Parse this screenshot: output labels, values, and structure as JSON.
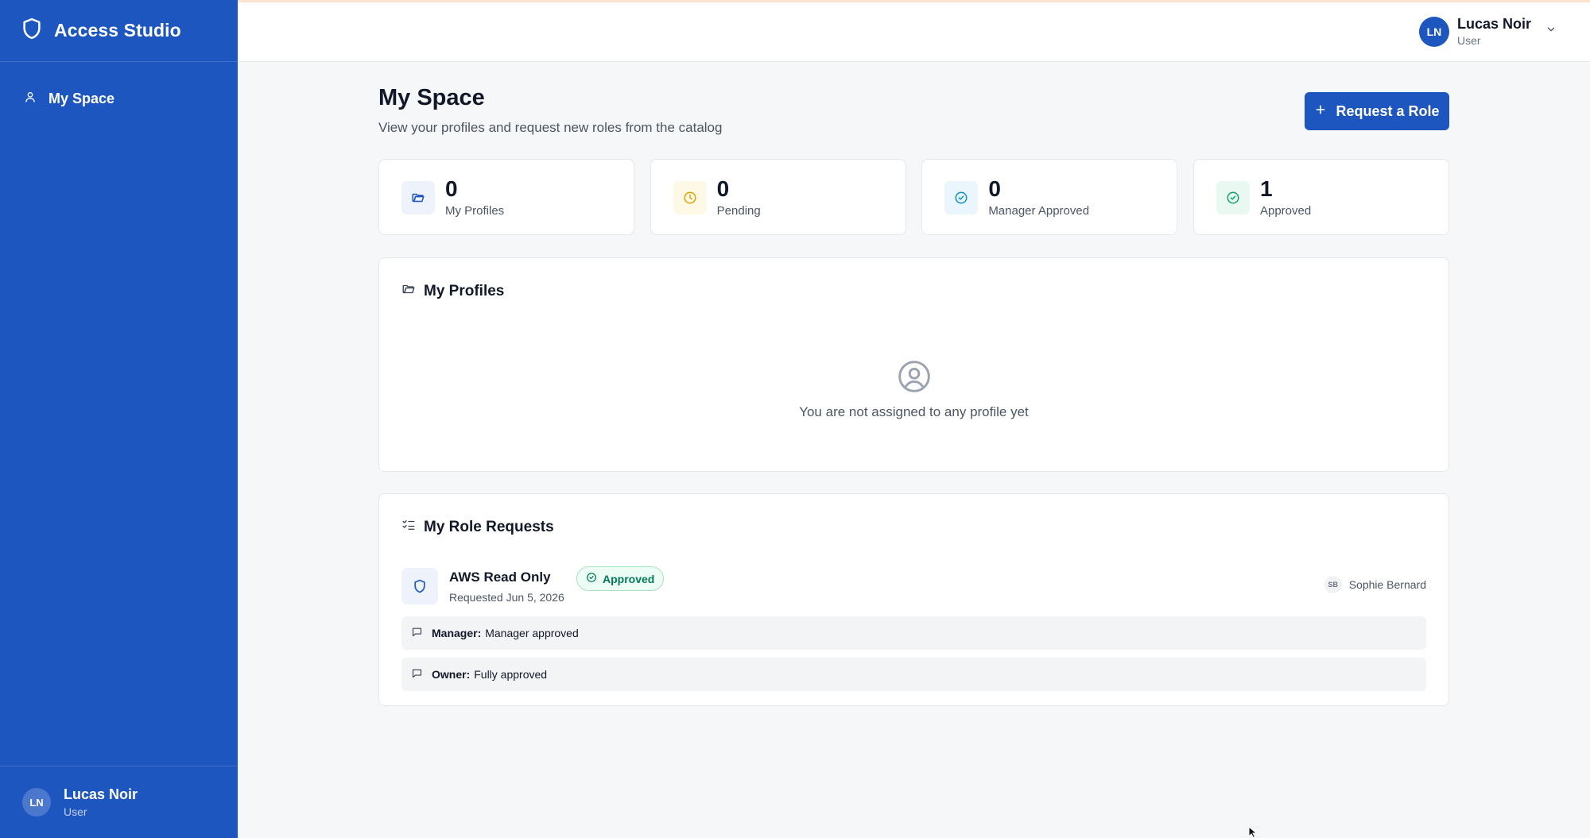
{
  "app": {
    "name": "Access Studio"
  },
  "sidebar": {
    "items": [
      {
        "label": "My Space",
        "icon": "user-icon"
      }
    ],
    "user": {
      "initials": "LN",
      "name": "Lucas Noir",
      "role": "User"
    }
  },
  "topbar": {
    "user": {
      "initials": "LN",
      "name": "Lucas Noir",
      "role": "User"
    }
  },
  "page": {
    "title": "My Space",
    "subtitle": "View your profiles and request new roles from the catalog",
    "request_button": "Request a Role"
  },
  "stats": [
    {
      "value": "0",
      "label": "My Profiles",
      "icon": "folder-icon",
      "color": "#1e56c0"
    },
    {
      "value": "0",
      "label": "Pending",
      "icon": "clock-icon",
      "color": "#e0a100"
    },
    {
      "value": "0",
      "label": "Manager Approved",
      "icon": "check-circle-icon",
      "color": "#0e8fc7"
    },
    {
      "value": "1",
      "label": "Approved",
      "icon": "check-circle-icon",
      "color": "#10a46b"
    }
  ],
  "profiles": {
    "title": "My Profiles",
    "empty_text": "You are not assigned to any profile yet"
  },
  "requests": {
    "title": "My Role Requests",
    "items": [
      {
        "role": "AWS Read Only",
        "status": "Approved",
        "requested": "Requested Jun 5, 2026",
        "approver_initials": "SB",
        "approver": "Sophie Bernard",
        "comments": [
          {
            "who": "Manager:",
            "text": "Manager approved"
          },
          {
            "who": "Owner:",
            "text": "Fully approved"
          }
        ]
      }
    ]
  }
}
